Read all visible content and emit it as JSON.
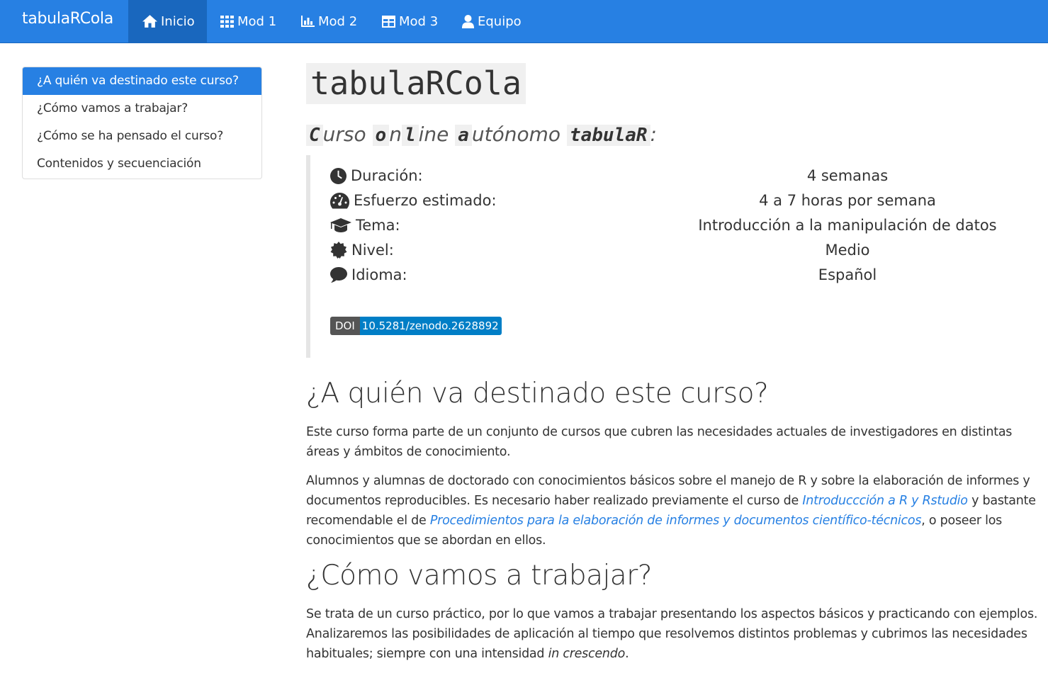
{
  "navbar": {
    "brand": "tabulaRCola",
    "items": [
      {
        "label": "Inicio",
        "icon": "home-icon"
      },
      {
        "label": "Mod 1",
        "icon": "grid-icon"
      },
      {
        "label": "Mod 2",
        "icon": "bar-chart-icon"
      },
      {
        "label": "Mod 3",
        "icon": "table-icon"
      },
      {
        "label": "Equipo",
        "icon": "user-icon"
      }
    ],
    "active": "Inicio"
  },
  "toc": {
    "items": [
      "¿A quién va destinado este curso?",
      "¿Cómo vamos a trabajar?",
      "¿Cómo se ha pensado el curso?",
      "Contenidos y secuenciación"
    ],
    "active_index": 0
  },
  "header": {
    "title": "tabulaRCola",
    "subtitle": [
      {
        "t": "C",
        "code": true
      },
      {
        "t": "urso ",
        "code": false
      },
      {
        "t": "o",
        "code": true
      },
      {
        "t": "n",
        "code": false
      },
      {
        "t": "l",
        "code": true
      },
      {
        "t": "ine ",
        "code": false
      },
      {
        "t": "a",
        "code": true
      },
      {
        "t": "utónomo ",
        "code": false
      },
      {
        "t": "tabulaR",
        "code": true
      },
      {
        "t": ":",
        "code": false
      }
    ]
  },
  "info": [
    {
      "icon": "clock-icon",
      "label": "Duración:",
      "value": "4 semanas"
    },
    {
      "icon": "tachometer-icon",
      "label": "Esfuerzo estimado:",
      "value": "4 a 7 horas por semana"
    },
    {
      "icon": "graduation-cap-icon",
      "label": "Tema:",
      "value": "Introducción a la manipulación de datos"
    },
    {
      "icon": "certificate-icon",
      "label": "Nivel:",
      "value": "Medio"
    },
    {
      "icon": "comment-icon",
      "label": "Idioma:",
      "value": "Español"
    }
  ],
  "doi_badge": {
    "key": "DOI",
    "value": "10.5281/zenodo.2628892"
  },
  "sections": {
    "s1": {
      "heading": "¿A quién va destinado este curso?",
      "p1": "Este curso forma parte de un conjunto de cursos que cubren las necesidades actuales de investigadores en distintas áreas y ámbitos de conocimiento.",
      "p2_a": "Alumnos y alumnas de doctorado con conocimientos básicos sobre el manejo de R y sobre la elaboración de informes y documentos reproducibles. Es necesario haber realizado previamente el curso de ",
      "p2_link1": "Introduccción a R y Rstudio",
      "p2_b": " y bastante recomendable el de ",
      "p2_link2": "Procedimientos para la elaboración de informes y documentos científico-técnicos",
      "p2_c": ", o poseer los conocimientos que se abordan en ellos."
    },
    "s2": {
      "heading": "¿Cómo vamos a trabajar?",
      "p1_a": "Se trata de un curso práctico, por lo que vamos a trabajar presentando los aspectos básicos y practicando con ejemplos. Analizaremos las posibilidades de aplicación al tiempo que resolvemos distintos problemas y cubrimos las necesidades habituales; siempre con una intensidad ",
      "p1_em": "in crescendo",
      "p1_b": "."
    }
  },
  "colors": {
    "primary": "#2780e3",
    "primary_dark": "#1967be",
    "doi_blue": "#007ec6",
    "doi_grey": "#555555"
  }
}
